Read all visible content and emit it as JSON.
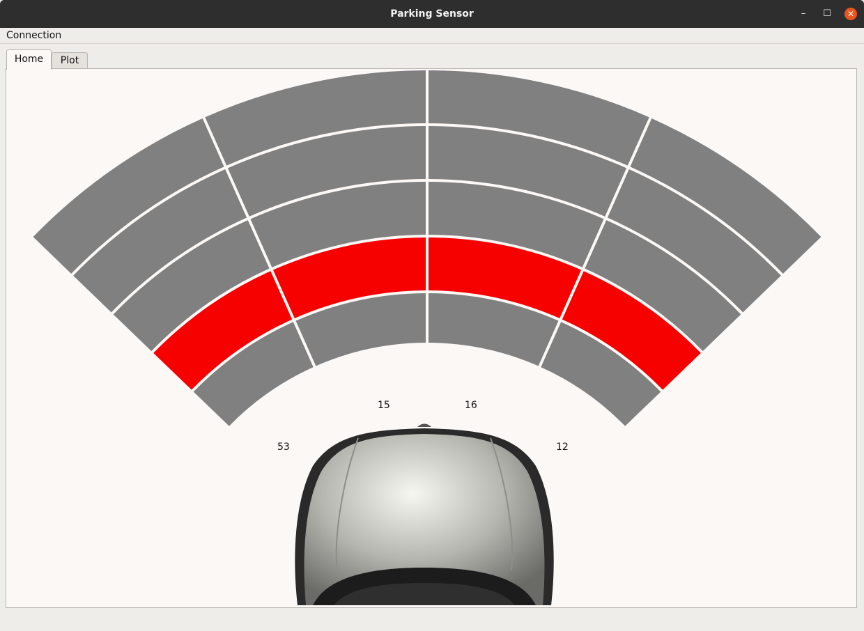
{
  "window": {
    "title": "Parking Sensor"
  },
  "menu": {
    "items": [
      "Connection"
    ]
  },
  "tabs": [
    {
      "label": "Home",
      "active": true
    },
    {
      "label": "Plot",
      "active": false
    }
  ],
  "sensors": {
    "readings": [
      "53",
      "15",
      "16",
      "12"
    ],
    "highlight_levels_from_car": [
      2,
      2,
      2,
      2
    ],
    "colors": {
      "inactive": "#808080",
      "active": "#f60000"
    }
  },
  "car": {
    "icon": "car-top-view-icon"
  }
}
